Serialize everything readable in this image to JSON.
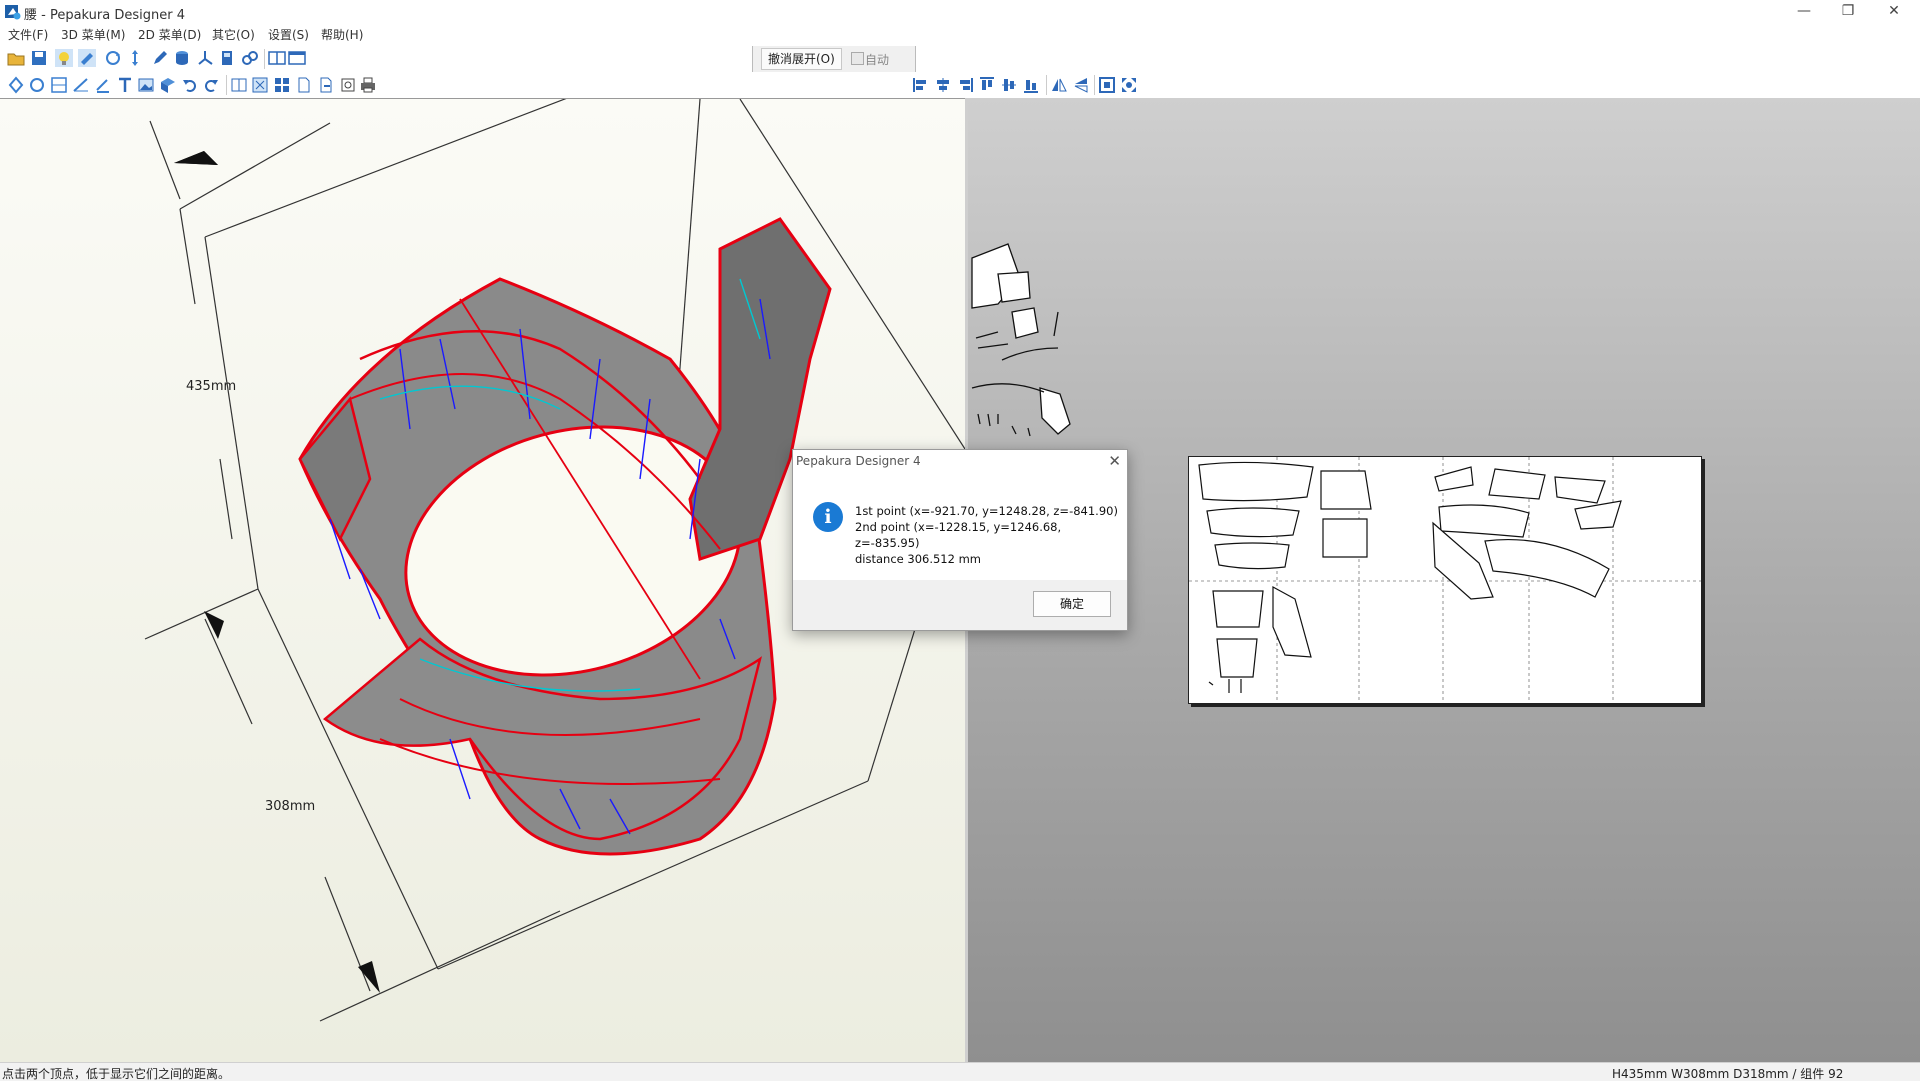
{
  "window": {
    "title": "腰 - Pepakura Designer 4",
    "controls": {
      "minimize": "—",
      "restore": "❐",
      "close": "✕"
    }
  },
  "menu": {
    "items": [
      "文件(F)",
      "3D 菜单(M)",
      "2D 菜单(D)",
      "其它(O)",
      "设置(S)",
      "帮助(H)"
    ]
  },
  "toolbar": {
    "unfold_cancel_label": "撤消展开(O)",
    "auto_label": "自动",
    "row1_icons": [
      "open-icon",
      "save-icon",
      "light-icon",
      "paint-icon",
      "rotate-icon",
      "move-icon",
      "edit-icon",
      "solid-icon",
      "axis-icon",
      "texture-icon",
      "link-icon",
      "split-view-icon",
      "single-view-icon"
    ],
    "row2_icons": [
      "select-icon",
      "rotate-part-icon",
      "join-icon",
      "fold-icon",
      "cut-icon",
      "text-icon",
      "image-icon",
      "flap-icon",
      "undo-icon",
      "redo-icon",
      "layout-icon",
      "fit-icon",
      "arrange-icon",
      "page-icon",
      "export-icon",
      "print-preview-icon",
      "print-icon"
    ],
    "align_icons": [
      "align-left-icon",
      "align-center-icon",
      "align-right-icon",
      "align-top-icon",
      "align-middle-icon",
      "align-bottom-icon",
      "flip-h-icon",
      "flip-v-icon",
      "zoom-fit-icon",
      "zoom-parts-icon"
    ]
  },
  "view3d": {
    "dimensions": {
      "height": "435mm",
      "width": "308mm"
    }
  },
  "dialog": {
    "title": "Pepakura Designer 4",
    "line1": "1st point (x=-921.70, y=1248.28, z=-841.90)",
    "line2": "2nd point (x=-1228.15, y=1246.68, z=-835.95)",
    "line3": "distance 306.512 mm",
    "ok_label": "确定",
    "close_icon": "✕",
    "info_glyph": "i"
  },
  "status": {
    "left": "点击两个顶点，低于显示它们之间的距离。",
    "right": "H435mm W308mm D318mm / 组件 92"
  },
  "colors": {
    "edge_red": "#e60012",
    "valley_blue": "#1a1aff",
    "cyan": "#00c8d2",
    "mesh_gray": "#7f7f7f",
    "info_blue": "#1a7ad4"
  }
}
